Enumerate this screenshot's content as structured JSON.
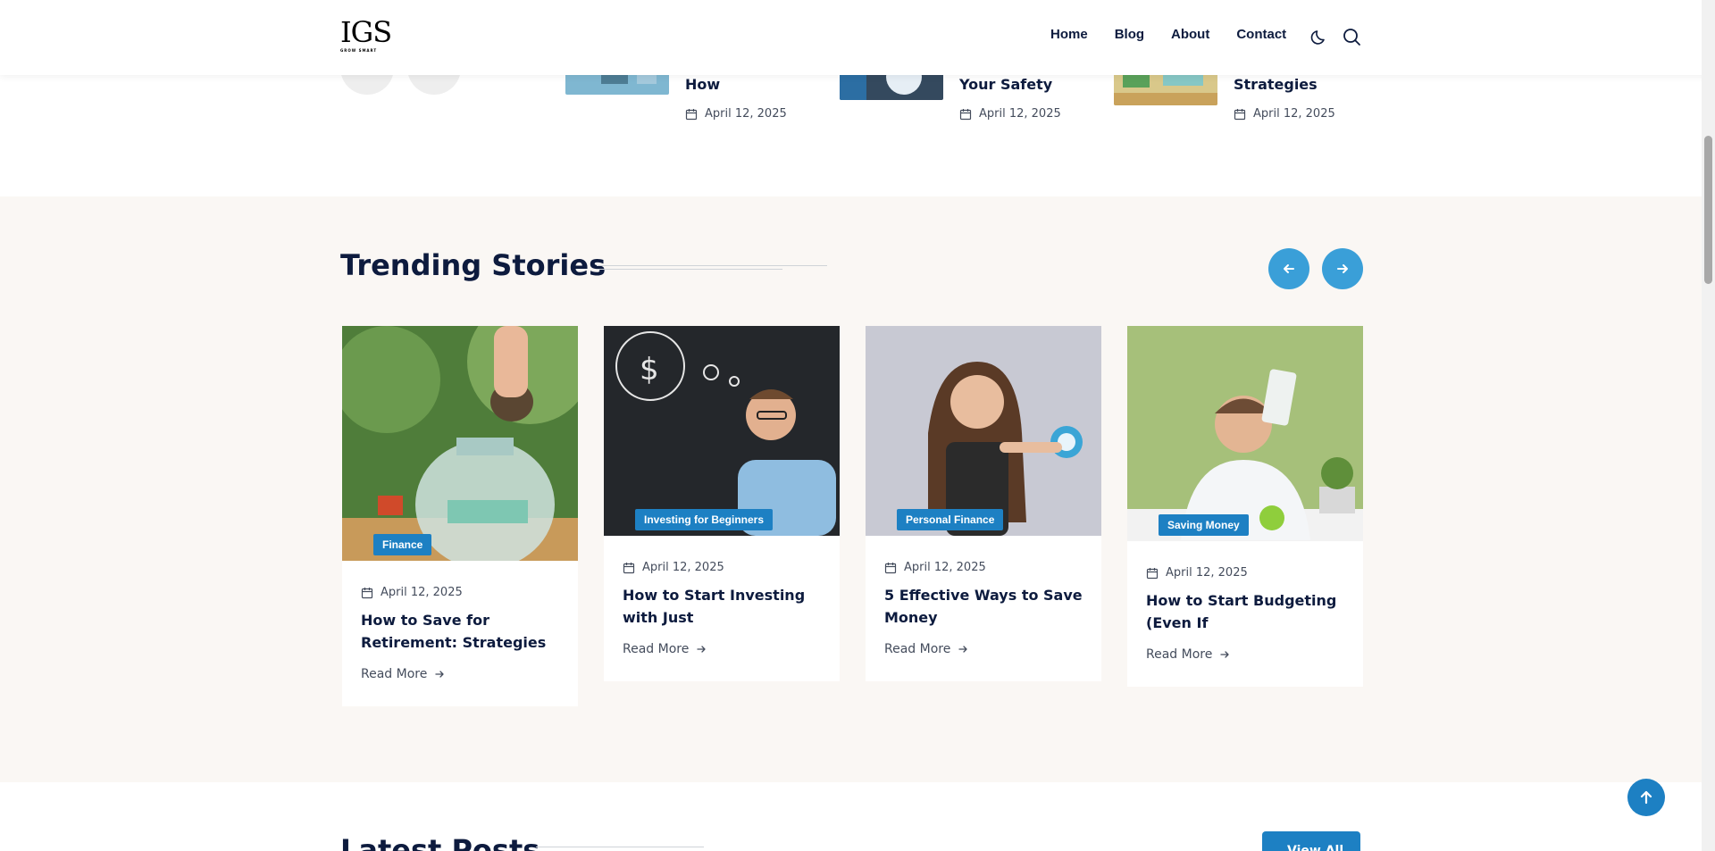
{
  "header": {
    "logo_text": "IGS",
    "logo_tagline": "GROW SMART",
    "nav": [
      "Home",
      "Blog",
      "About",
      "Contact"
    ],
    "theme_icon": "moon-icon",
    "search_icon": "search-icon"
  },
  "top_posts": [
    {
      "title": "How",
      "date": "April 12, 2025"
    },
    {
      "title": "Your Safety",
      "date": "April 12, 2025"
    },
    {
      "title": "Strategies",
      "date": "April 12, 2025"
    }
  ],
  "trending": {
    "title": "Trending Stories",
    "prev_icon": "arrow-left-icon",
    "next_icon": "arrow-right-icon",
    "cards": [
      {
        "category": "Finance",
        "date": "April 12, 2025",
        "title": "How to Save for Retirement: Strategies",
        "read_more": "Read More"
      },
      {
        "category": "Investing for Beginners",
        "date": "April 12, 2025",
        "title": "How to Start Investing with Just",
        "read_more": "Read More"
      },
      {
        "category": "Personal Finance",
        "date": "April 12, 2025",
        "title": "5 Effective Ways to Save Money",
        "read_more": "Read More"
      },
      {
        "category": "Saving Money",
        "date": "April 12, 2025",
        "title": "How to Start Budgeting (Even If",
        "read_more": "Read More"
      }
    ]
  },
  "latest": {
    "title": "Latest Posts",
    "view_all": "View All"
  },
  "colors": {
    "accent": "#1d80c3",
    "arrow_button": "#3a9fd8",
    "heading": "#0d1b3e",
    "section_bg": "#faf7f4"
  }
}
